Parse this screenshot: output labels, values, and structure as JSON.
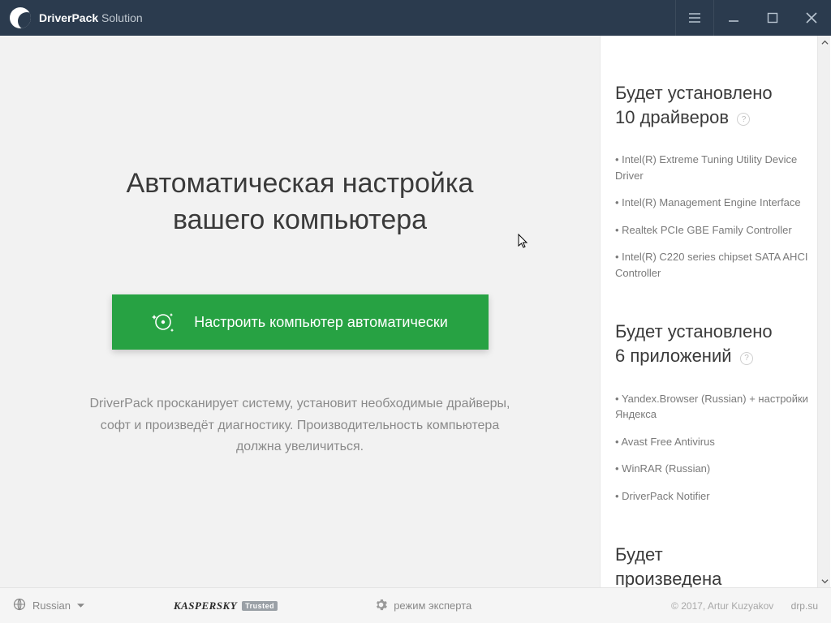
{
  "titlebar": {
    "brand_bold": "DriverPack",
    "brand_light": " Solution"
  },
  "hero": {
    "line1": "Автоматическая настройка",
    "line2": "вашего компьютера"
  },
  "cta": {
    "label": "Настроить компьютер автоматически"
  },
  "description": "DriverPack просканирует систему, установит необходимые драйверы, софт и произведёт диагностику. Производительность компьютера должна увеличиться.",
  "sidebar": {
    "drivers": {
      "title_l1": "Будет установлено",
      "title_l2": "10 драйверов",
      "items": [
        "Intel(R) Extreme Tuning Utility Device Driver",
        "Intel(R) Management Engine Interface",
        "Realtek PCIe GBE Family Controller",
        "Intel(R) C220 series chipset SATA AHCI Controller"
      ]
    },
    "apps": {
      "title_l1": "Будет установлено",
      "title_l2": "6 приложений",
      "items": [
        "Yandex.Browser (Russian) + настройки Яндекса",
        "Avast Free Antivirus",
        "WinRAR (Russian)",
        "DriverPack Notifier"
      ]
    },
    "diag": {
      "title_l1": "Будет",
      "title_l2": "произведена"
    }
  },
  "footer": {
    "language": "Russian",
    "kaspersky": "KASPERSKY",
    "trusted": "Trusted",
    "expert": "режим эксперта",
    "copyright": "© 2017, Artur Kuzyakov",
    "site": "drp.su"
  },
  "help_badge": "?"
}
